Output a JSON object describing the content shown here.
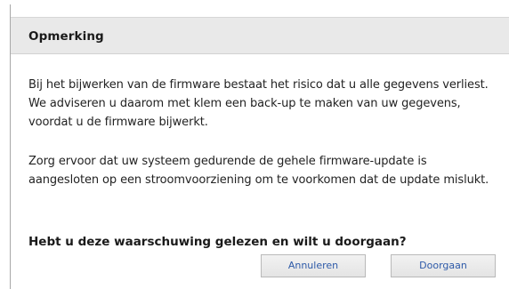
{
  "dialog": {
    "title": "Opmerking",
    "paragraph1": "Bij het bijwerken van de firmware bestaat het risico dat u alle gegevens verliest. We adviseren u daarom met klem een back-up te maken van uw gegevens, voordat u de firmware bijwerkt.",
    "paragraph2": "Zorg ervoor dat uw systeem gedurende de gehele firmware-update is aangesloten op een stroomvoorziening om te voorkomen dat de update mislukt.",
    "question": "Hebt u deze waarschuwing gelezen en wilt u doorgaan?",
    "buttons": {
      "cancel_label": "Annuleren",
      "continue_label": "Doorgaan"
    }
  },
  "colors": {
    "header_bg": "#e9e9e9",
    "button_text": "#2e5aa8"
  }
}
